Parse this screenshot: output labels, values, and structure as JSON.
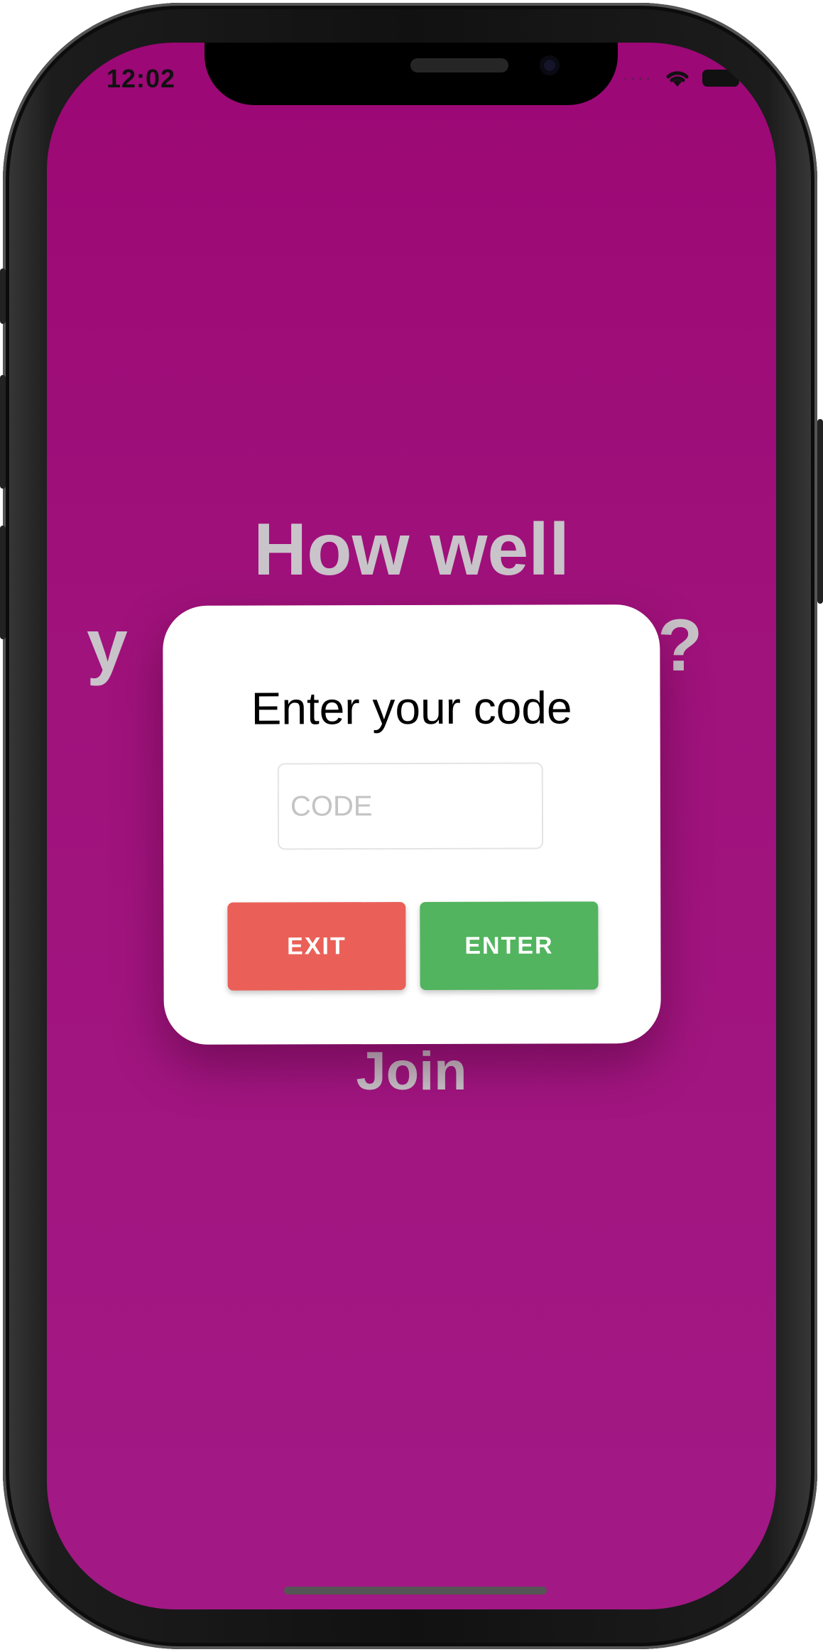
{
  "status_bar": {
    "time": "12:02",
    "signal_dots": "····"
  },
  "background": {
    "title_line1": "How well",
    "title_line2_left": "y",
    "title_line2_right": "?",
    "join_label": "Join",
    "text_color": "#c9c4c9",
    "bg_color": "#a0127c"
  },
  "modal": {
    "title": "Enter your code",
    "code_input": {
      "value": "",
      "placeholder": "CODE"
    },
    "exit_label": "EXIT",
    "enter_label": "ENTER",
    "exit_color": "#ea6058",
    "enter_color": "#52b45e"
  }
}
